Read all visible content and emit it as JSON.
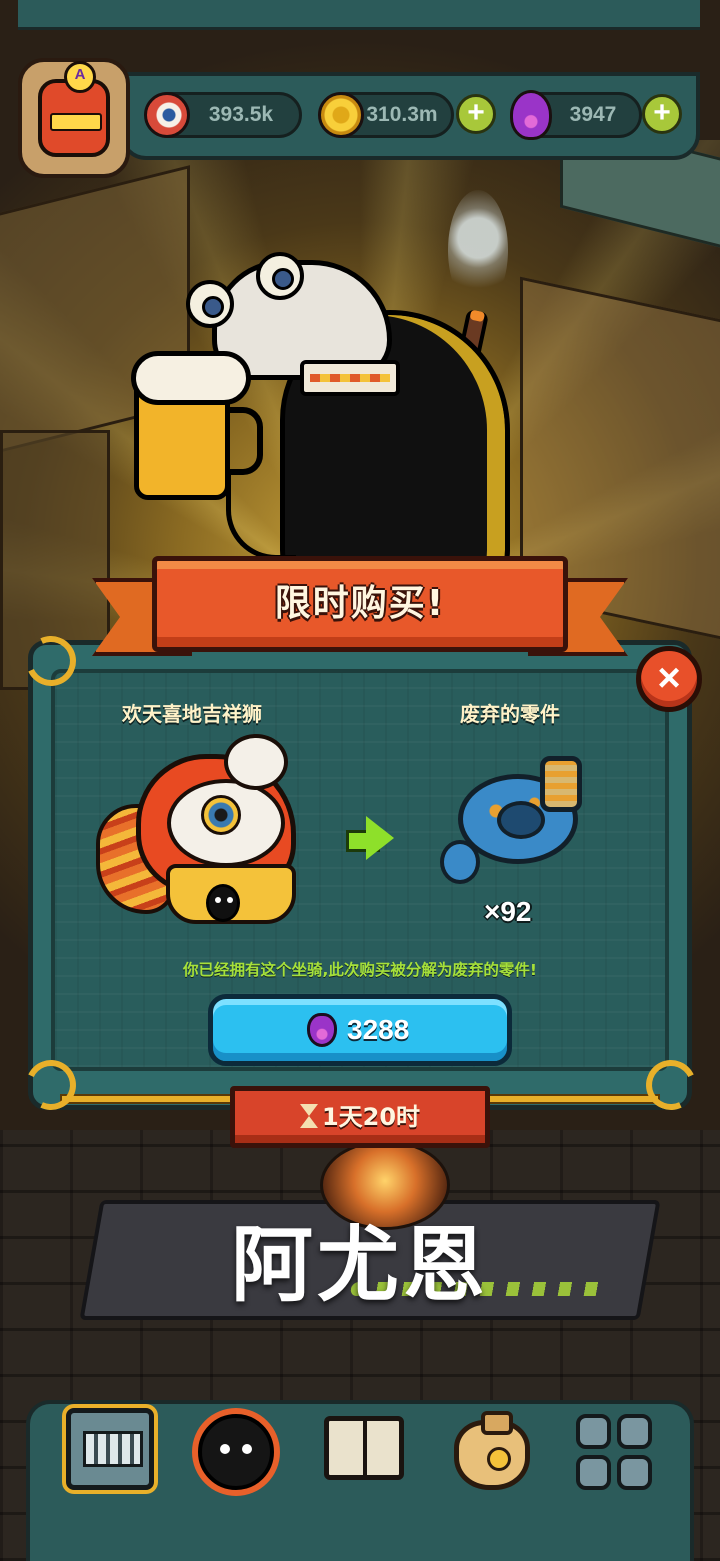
{
  "hud": {
    "eyes": "393.5k",
    "coins": "310.3m",
    "potions": "3947",
    "plus_symbol": "+"
  },
  "offer": {
    "title": "限时购买!",
    "close_symbol": "×",
    "from_item": "欢天喜地吉祥狮",
    "to_item": "废弃的零件",
    "to_quantity": "×92",
    "notice": "你已经拥有这个坐骑,此次购买被分解为废弃的零件!",
    "price": "3288",
    "timer": "1天20时"
  },
  "watermark": "阿尤恩",
  "nav": {
    "items": [
      {
        "icon": "machine-icon"
      },
      {
        "icon": "bug-character-icon"
      },
      {
        "icon": "book-icon"
      },
      {
        "icon": "money-bag-icon"
      },
      {
        "icon": "grid-menu-icon"
      }
    ]
  },
  "colors": {
    "panel": "#2f6b6a",
    "banner": "#e8582a",
    "buy_button": "#2cc0f0",
    "notice_text": "#a6e03a",
    "gold_trim": "#e8b02a"
  }
}
